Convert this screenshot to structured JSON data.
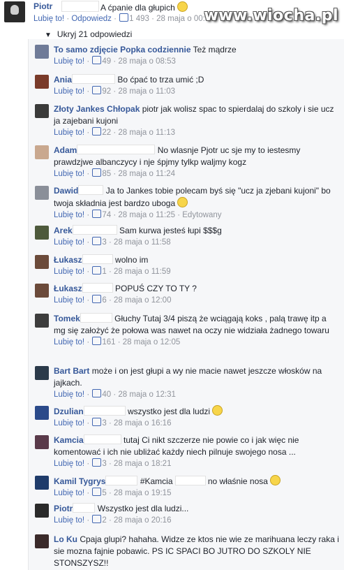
{
  "watermark": "www.wiocha.pl",
  "top_comment": {
    "author": "Piotr",
    "text": "A ćpanie dla głupich",
    "like": "Lubię to!",
    "reply": "Odpowiedz",
    "likes": "1 493",
    "time": "28 maja o 00:5"
  },
  "hide_replies": "Ukryj 21 odpowiedzi",
  "replies": [
    {
      "author": "To samo zdjęcie Popka codziennie",
      "blank": 0,
      "text": "Też mądrze",
      "likes": "49",
      "time": "28 maja o 08:53",
      "edited": "",
      "emoji": false,
      "color": "#6f7b98"
    },
    {
      "author": "Ania",
      "blank": 60,
      "text": "Bo ćpać to trza umić ;D",
      "likes": "92",
      "time": "28 maja o 11:03",
      "edited": "",
      "emoji": false,
      "color": "#7a3b2a"
    },
    {
      "author": "Złoty Jankes Chłopak",
      "blank": 0,
      "text": "piotr jak wolisz spac to spierdalaj do szkoly i sie ucz ja zajebani kujoni",
      "likes": "22",
      "time": "28 maja o 11:13",
      "edited": "",
      "emoji": false,
      "color": "#3a3a3a"
    },
    {
      "author": "Adam",
      "blank": 110,
      "text": "No wlasnje Pjotr uc sje my to iestesmy prawdzjwe albanczycy i nje śpjmy tylkp waljmy kogz",
      "likes": "85",
      "time": "28 maja o 11:24",
      "edited": "",
      "emoji": false,
      "color": "#c9a88f"
    },
    {
      "author": "Dawid",
      "blank": 34,
      "text": "Ja to Jankes tobie polecam byś się \"ucz ja zjebani kujoni\" bo twoja składnia jest bardzo uboga",
      "likes": "74",
      "time": "28 maja o 11:25",
      "edited": "Edytowany",
      "emoji": true,
      "color": "#8a8f99"
    },
    {
      "author": "Arek",
      "blank": 62,
      "text": "Sam kurwa jesteś łupi $$$g",
      "likes": "3",
      "time": "28 maja o 11:58",
      "edited": "",
      "emoji": false,
      "color": "#4e5a3c"
    },
    {
      "author": "Łukasz",
      "blank": 42,
      "text": "wolno im",
      "likes": "1",
      "time": "28 maja o 11:59",
      "edited": "",
      "emoji": false,
      "color": "#6b4a3a"
    },
    {
      "author": "Łukasz",
      "blank": 42,
      "text": "POPUŚ CZY TO TY ?",
      "likes": "6",
      "time": "28 maja o 12:00",
      "edited": "",
      "emoji": false,
      "color": "#6b4a3a"
    },
    {
      "author": "Tomek",
      "blank": 44,
      "text": "Głuchy Tutaj 3/4 piszą że wciągają koks , palą trawę itp a mg się założyć że połowa was nawet na oczy nie widziała żadnego towaru",
      "likes": "161",
      "time": "28 maja o 12:05",
      "edited": "",
      "emoji": false,
      "color": "#3d3d3d"
    },
    {
      "author": "Bart Bart",
      "blank": 0,
      "text": "może i on jest głupi a wy nie macie nawet jeszcze włosków na jajkach.",
      "likes": "40",
      "time": "28 maja o 12:31",
      "edited": "",
      "emoji": false,
      "color": "#2b3a4a"
    },
    {
      "author": "Dzulian",
      "blank": 58,
      "text": "wszystko jest dla ludzi",
      "likes": "3",
      "time": "28 maja o 16:16",
      "edited": "",
      "emoji": true,
      "color": "#2b4a8a"
    },
    {
      "author": "Kamcia",
      "blank": 52,
      "text": "tutaj Ci nikt szczerze nie powie co i jak więc nie komentować i ich nie ubliżać każdy niech pilnuje swojego nosa ...",
      "likes": "3",
      "time": "28 maja o 18:21",
      "edited": "",
      "emoji": false,
      "color": "#5a3a4a"
    },
    {
      "author": "Kamil Tygrys",
      "blank": 44,
      "text": "#Kamcia",
      "text2": "no właśnie nosa",
      "blank2": 42,
      "likes": "5",
      "time": "28 maja o 19:15",
      "edited": "",
      "emoji": true,
      "color": "#1f3b6a"
    },
    {
      "author": "Piotr",
      "blank": 30,
      "text": "Wszystko jest dla ludzi...",
      "likes": "2",
      "time": "28 maja o 20:16",
      "edited": "",
      "emoji": false,
      "color": "#2a2a2a"
    },
    {
      "author": "Lo Ku",
      "blank": 0,
      "text": "Cpaja glupi? hahaha. Widze ze ktos nie wie ze marihuana leczy raka i sie mozna fajnie pobawic. PS IC SPACI BO JUTRO DO SZKOLY NIE STONSZYSZ!!",
      "likes": "",
      "time": "",
      "edited": "",
      "emoji": false,
      "color": "#3a2a2a"
    }
  ],
  "like_label": "Lubię to!"
}
